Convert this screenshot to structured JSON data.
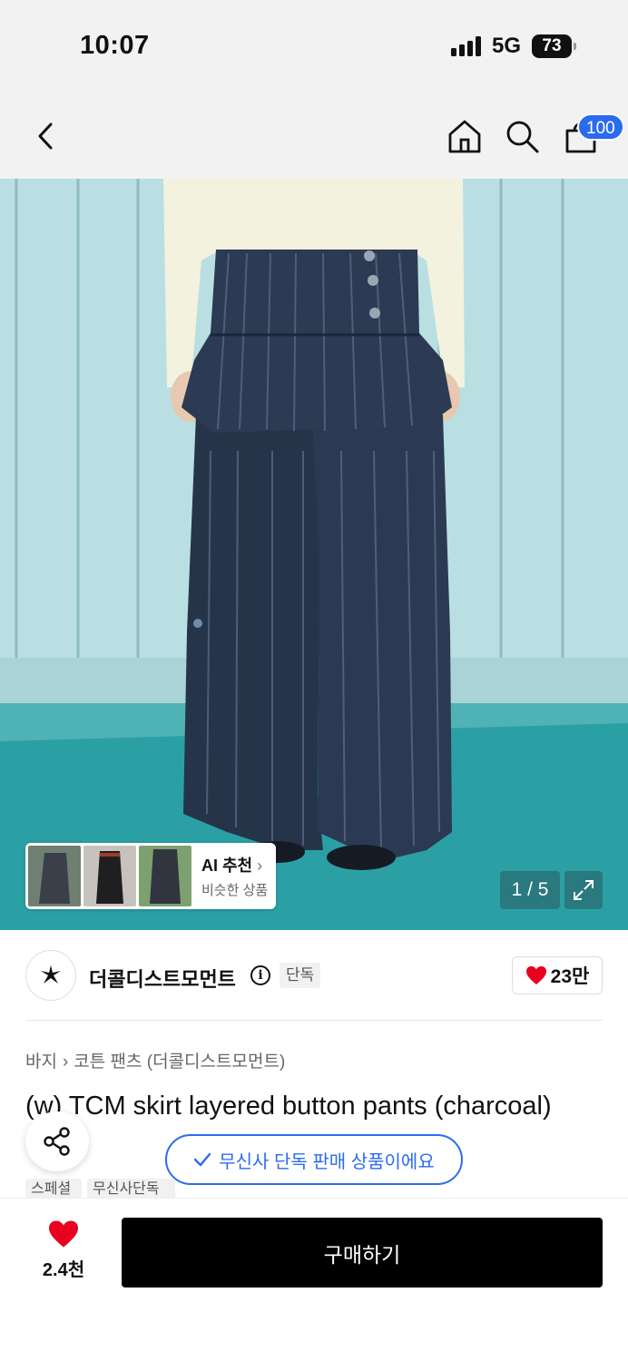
{
  "status_bar": {
    "time": "10:07",
    "network": "5G",
    "battery": "73"
  },
  "header": {
    "cart_count": "100"
  },
  "icons": {
    "back": "chevron-left-icon",
    "home": "home-icon",
    "search": "search-icon",
    "cart": "shopping-bag-icon"
  },
  "gallery": {
    "counter": "1 / 5",
    "ai_card": {
      "title": "AI 추천",
      "subtitle": "비슷한 상품"
    }
  },
  "brand": {
    "name": "더콜디스트모먼트",
    "badge": "단독",
    "likes": "23만"
  },
  "breadcrumb": {
    "category": "바지",
    "subcategory": "코튼 팬츠 (더콜디스트모먼트)"
  },
  "product": {
    "title": "(w) TCM skirt layered button pants (charcoal)",
    "exclusive_notice": "무신사 단독 판매 상품이에요",
    "tags": [
      "스페셜",
      "무신사단독"
    ]
  },
  "bottom": {
    "wish_count": "2.4천",
    "buy_label": "구매하기"
  },
  "colors": {
    "accent": "#2b6bf0",
    "heart": "#e8001e",
    "buy_button": "#000000",
    "wall": "#b9dfe3",
    "floor": "#2aa0a5",
    "pants": "#26344a",
    "top": "#f3f2df"
  }
}
